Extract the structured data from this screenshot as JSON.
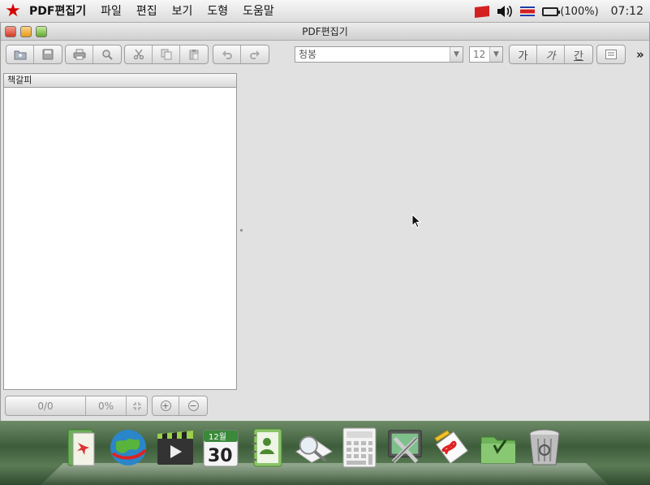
{
  "menubar": {
    "app_name": "PDF편집기",
    "items": [
      "파일",
      "편집",
      "보기",
      "도형",
      "도움말"
    ],
    "battery": "(100%)",
    "time": "07:12"
  },
  "window": {
    "title": "PDF편집기"
  },
  "toolbar": {
    "font_name": "청봉",
    "font_size": "12",
    "style_buttons": [
      "가",
      "가",
      "간"
    ],
    "more": "»"
  },
  "bookmarks": {
    "header": "책갈피"
  },
  "status": {
    "page": "0/0",
    "zoom": "0%",
    "fit": "⌗",
    "zoom_in": "+",
    "zoom_out": "−"
  },
  "dock": {
    "icons": [
      "documents-icon",
      "browser-globe-icon",
      "video-player-icon",
      "calendar-icon",
      "contacts-icon",
      "image-viewer-icon",
      "calculator-icon",
      "system-settings-icon",
      "pdf-editor-icon",
      "file-manager-icon",
      "trash-icon"
    ],
    "calendar_month": "12월",
    "calendar_day": "30"
  }
}
